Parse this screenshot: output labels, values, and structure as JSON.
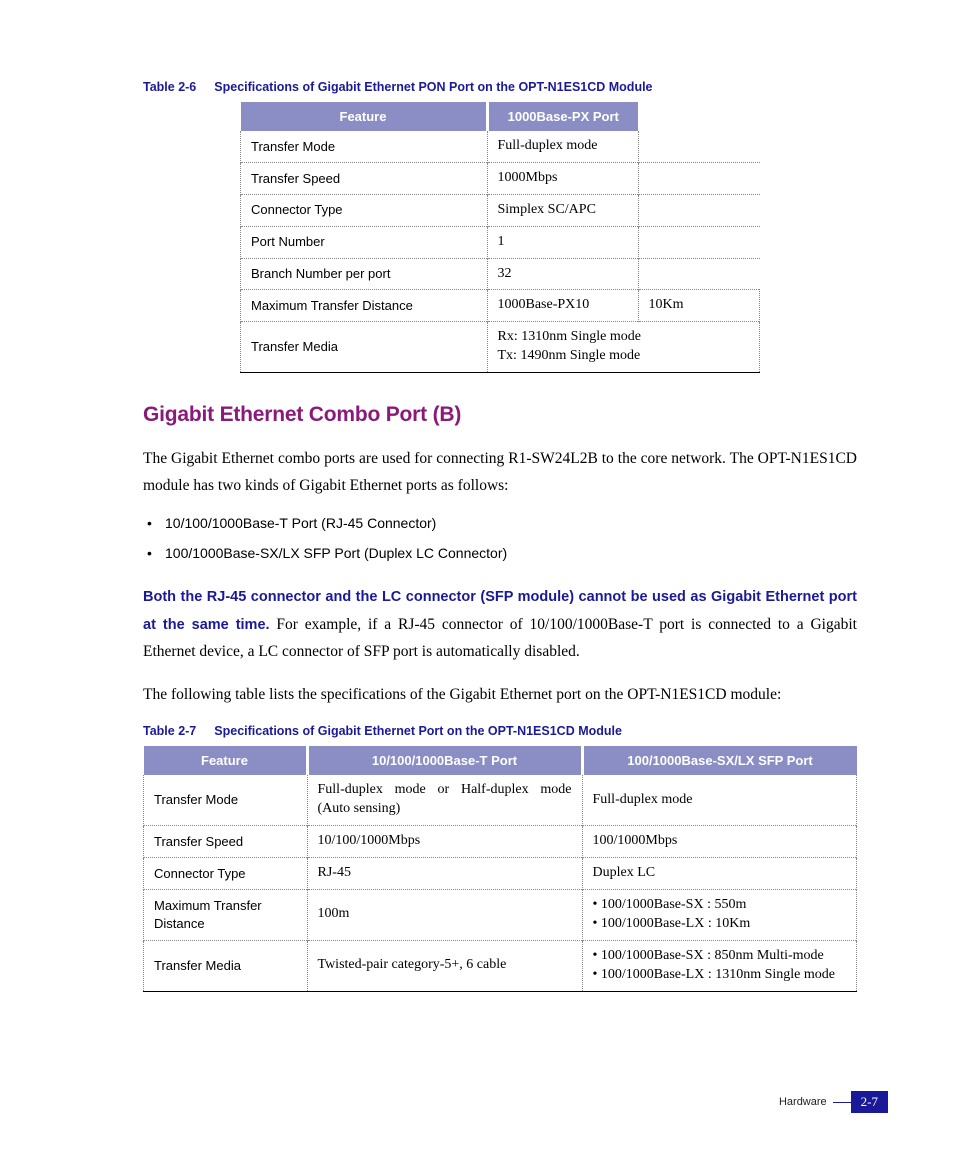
{
  "table1": {
    "caption_num": "Table 2-6",
    "caption": "Specifications of Gigabit Ethernet PON Port on the OPT-N1ES1CD Module",
    "headers": [
      "Feature",
      "1000Base-PX Port"
    ],
    "rows": {
      "r1": {
        "f": "Transfer Mode",
        "v": "Full-duplex mode"
      },
      "r2": {
        "f": "Transfer Speed",
        "v": "1000Mbps"
      },
      "r3": {
        "f": "Connector Type",
        "v": "Simplex SC/APC"
      },
      "r4": {
        "f": "Port Number",
        "v": "1"
      },
      "r5": {
        "f": "Branch Number per port",
        "v": "32"
      },
      "r6": {
        "f": "Maximum Transfer Distance",
        "v1": "1000Base-PX10",
        "v2": "10Km"
      },
      "r7": {
        "f": "Transfer Media",
        "v1": "Rx: 1310nm Single mode",
        "v2": "Tx: 1490nm Single mode"
      }
    }
  },
  "heading": "Gigabit Ethernet Combo Port (B)",
  "para1": "The Gigabit Ethernet combo ports are used for connecting R1-SW24L2B to the core network. The OPT-N1ES1CD module has two kinds of Gigabit Ethernet ports as follows:",
  "bullets": [
    "10/100/1000Base-T Port (RJ-45 Connector)",
    "100/1000Base-SX/LX SFP Port (Duplex LC Connector)"
  ],
  "note_bold": "Both the RJ-45 connector and the LC connector (SFP module) cannot be used as Gigabit Ethernet port at the same time.",
  "note_rest": " For example, if a RJ-45 connector of 10/100/1000Base-T port is connected to a Gigabit Ethernet device, a LC connector of SFP port is automatically disabled.",
  "para2": "The following table lists the specifications of the Gigabit Ethernet port on the OPT-N1ES1CD module:",
  "table2": {
    "caption_num": "Table 2-7",
    "caption": "Specifications of Gigabit Ethernet Port on the OPT-N1ES1CD Module",
    "headers": [
      "Feature",
      "10/100/1000Base-T Port",
      "100/1000Base-SX/LX SFP Port"
    ],
    "rows": {
      "r1": {
        "f": "Transfer Mode",
        "v1": "Full-duplex mode or Half-duplex mode (Auto sensing)",
        "v2": "Full-duplex mode"
      },
      "r2": {
        "f": "Transfer Speed",
        "v1": "10/100/1000Mbps",
        "v2": "100/1000Mbps"
      },
      "r3": {
        "f": "Connector Type",
        "v1": "RJ-45",
        "v2": "Duplex LC"
      },
      "r4": {
        "f": "Maximum Transfer Distance",
        "v1": "100m",
        "v2a": "• 100/1000Base-SX : 550m",
        "v2b": "• 100/1000Base-LX : 10Km"
      },
      "r5": {
        "f": "Transfer Media",
        "v1": "Twisted-pair category-5+, 6 cable",
        "v2a": "• 100/1000Base-SX : 850nm Multi-mode",
        "v2b": "• 100/1000Base-LX : 1310nm Single mode"
      }
    }
  },
  "footer": {
    "label": "Hardware",
    "page": "2-7"
  }
}
